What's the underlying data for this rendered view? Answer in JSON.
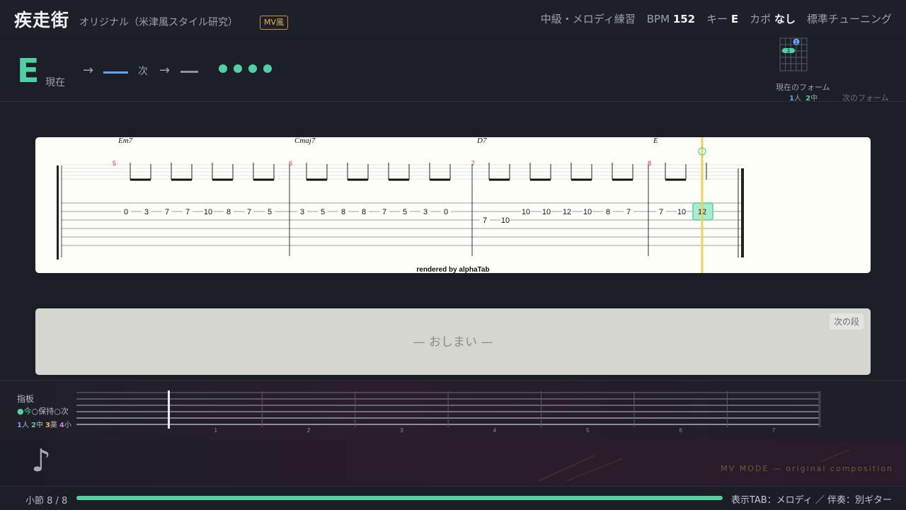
{
  "header": {
    "title": "疾走街",
    "subtitle": "オリジナル（米津風スタイル研究）",
    "badge": "MV風",
    "level": "中級・メロディ練習",
    "bpm_label": "BPM",
    "bpm_value": "152",
    "key_label": "キー",
    "key_value": "E",
    "capo_label": "カポ",
    "capo_value": "なし",
    "tuning": "標準チューニング"
  },
  "chord_bar": {
    "current_chord": "E",
    "current_label": "現在",
    "arrow": "→",
    "next_label": "次",
    "beats_total": 4,
    "beats_lit": 4,
    "form_current_label": "現在のフォーム",
    "finger_legend_1_num": "1",
    "finger_legend_1": "人",
    "finger_legend_2_num": "2",
    "finger_legend_2": "中",
    "form_next_label": "次のフォーム",
    "diagram_fingers": [
      "1",
      "2"
    ]
  },
  "tab": {
    "rendered_by": "rendered by alphaTab",
    "measures": [
      {
        "number": "5",
        "chord": "Em7",
        "notes": [
          {
            "fret": "0",
            "string": 2
          },
          {
            "fret": "3",
            "string": 2
          },
          {
            "fret": "7",
            "string": 2
          },
          {
            "fret": "7",
            "string": 2
          },
          {
            "fret": "10",
            "string": 2
          },
          {
            "fret": "8",
            "string": 2
          },
          {
            "fret": "7",
            "string": 2
          },
          {
            "fret": "5",
            "string": 2
          }
        ]
      },
      {
        "number": "6",
        "chord": "Cmaj7",
        "notes": [
          {
            "fret": "3",
            "string": 2
          },
          {
            "fret": "5",
            "string": 2
          },
          {
            "fret": "8",
            "string": 2
          },
          {
            "fret": "8",
            "string": 2
          },
          {
            "fret": "7",
            "string": 2
          },
          {
            "fret": "5",
            "string": 2
          },
          {
            "fret": "3",
            "string": 2
          },
          {
            "fret": "0",
            "string": 2
          }
        ]
      },
      {
        "number": "7",
        "chord": "D7",
        "notes": [
          {
            "fret": "7",
            "string": 3
          },
          {
            "fret": "10",
            "string": 3
          },
          {
            "fret": "10",
            "string": 2
          },
          {
            "fret": "10",
            "string": 2
          },
          {
            "fret": "12",
            "string": 2
          },
          {
            "fret": "10",
            "string": 2
          },
          {
            "fret": "8",
            "string": 2
          },
          {
            "fret": "7",
            "string": 2
          }
        ]
      },
      {
        "number": "8",
        "chord": "E",
        "notes": [
          {
            "fret": "7",
            "string": 2
          },
          {
            "fret": "10",
            "string": 2
          },
          {
            "fret": "12",
            "string": 2,
            "current": true
          }
        ]
      }
    ]
  },
  "next_panel": {
    "end_text": "— おしまい —",
    "next_row_button": "次の段"
  },
  "fretboard": {
    "title": "指板",
    "legend_now": "●今",
    "legend_hold": "○保持",
    "legend_next": "○次",
    "fingers": [
      {
        "num": "1",
        "name": "人",
        "color": "#6aa2f2"
      },
      {
        "num": "2",
        "name": "中",
        "color": "#4fd1a4"
      },
      {
        "num": "3",
        "name": "薬",
        "color": "#e8b25a"
      },
      {
        "num": "4",
        "name": "小",
        "color": "#d77ad6"
      }
    ],
    "fret_numbers": [
      "1",
      "2",
      "3",
      "4",
      "5",
      "6",
      "7"
    ]
  },
  "bottom": {
    "note_icon": "eighth-note-icon",
    "mv_mode": "MV MODE — original composition"
  },
  "status": {
    "measure_label": "小節 8 / 8",
    "progress": 1.0,
    "display_mode": "表示TAB：メロディ ／ 伴奏：別ギター"
  },
  "colors": {
    "accent": "#4fd1a4",
    "next_blue": "#6aa2f2",
    "playhead": "#f2cd5c",
    "measure_number": "#d0312d"
  }
}
